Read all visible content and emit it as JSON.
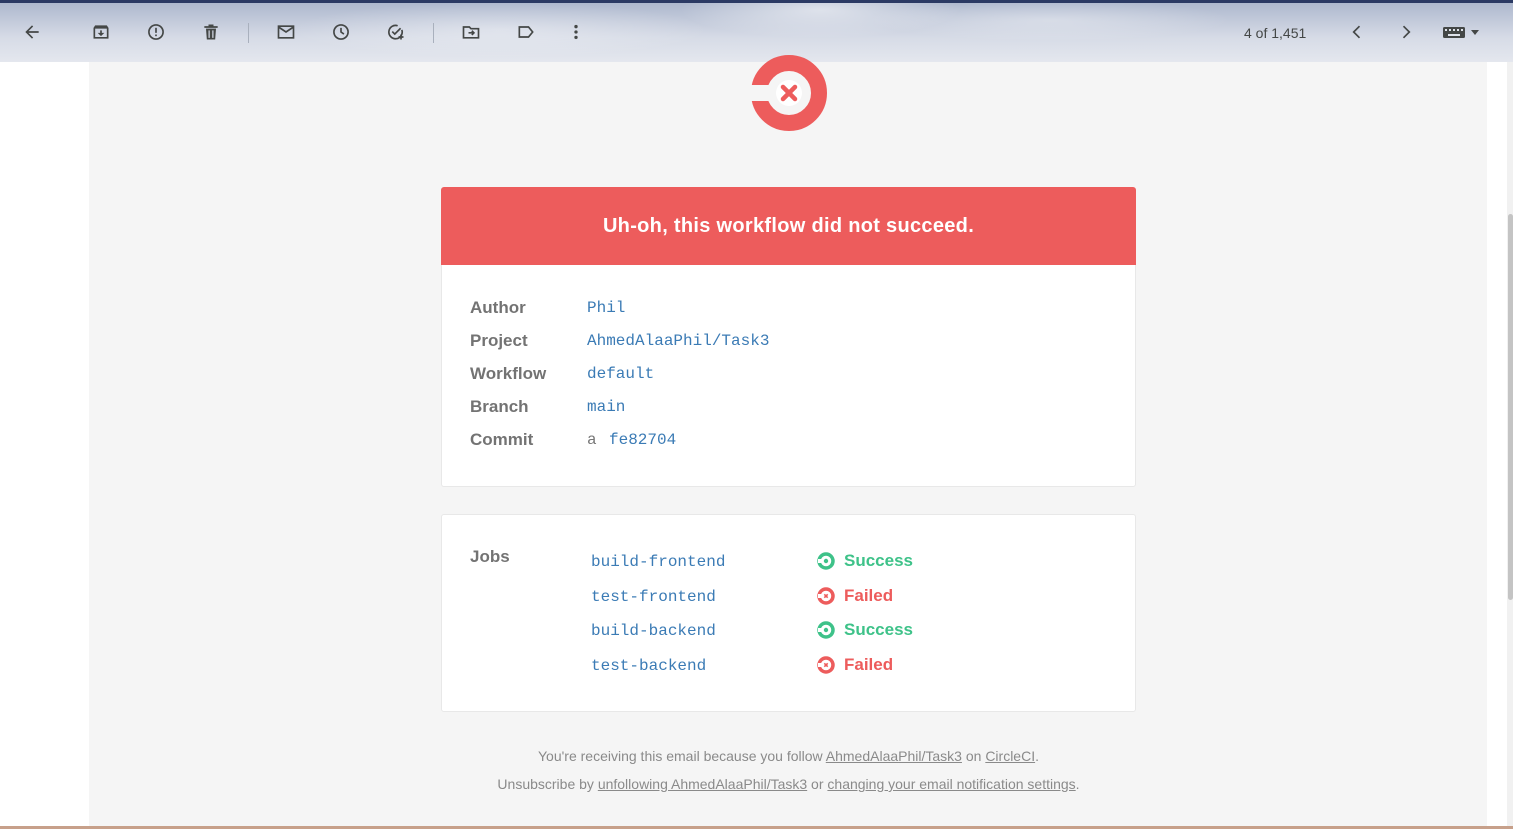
{
  "toolbar": {
    "counter": "4 of 1,451"
  },
  "banner": {
    "title": "Uh-oh, this workflow did not succeed."
  },
  "meta": {
    "rows": [
      {
        "label": "Author",
        "value": "Phil"
      },
      {
        "label": "Project",
        "value": "AhmedAlaaPhil/Task3"
      },
      {
        "label": "Workflow",
        "value": "default"
      },
      {
        "label": "Branch",
        "value": "main"
      },
      {
        "label": "Commit",
        "prefix": "a",
        "value": "fe82704"
      }
    ]
  },
  "jobs": {
    "label": "Jobs",
    "items": [
      {
        "name": "build-frontend",
        "status": "Success"
      },
      {
        "name": "test-frontend",
        "status": "Failed"
      },
      {
        "name": "build-backend",
        "status": "Success"
      },
      {
        "name": "test-backend",
        "status": "Failed"
      }
    ]
  },
  "footer": {
    "line1_prefix": "You're receiving this email because you follow ",
    "line1_link1": "AhmedAlaaPhil/Task3",
    "line1_mid": " on ",
    "line1_link2": "CircleCI",
    "line1_suffix": ".",
    "line2_prefix": "Unsubscribe by ",
    "line2_link1": "unfollowing AhmedAlaaPhil/Task3",
    "line2_mid": " or ",
    "line2_link2": "changing your email notification settings",
    "line2_suffix": "."
  },
  "colors": {
    "banner": "#ed5c5c",
    "success": "#3ec289",
    "failed": "#ed5c5c",
    "link": "#3b7bb5"
  },
  "icons": [
    "back-arrow-icon",
    "archive-icon",
    "report-spam-icon",
    "delete-icon",
    "mark-unread-icon",
    "snooze-icon",
    "add-task-icon",
    "move-to-icon",
    "label-icon",
    "more-vert-icon",
    "chevron-left-icon",
    "chevron-right-icon",
    "keyboard-icon",
    "circleci-failed-logo",
    "success-icon",
    "failed-icon"
  ]
}
